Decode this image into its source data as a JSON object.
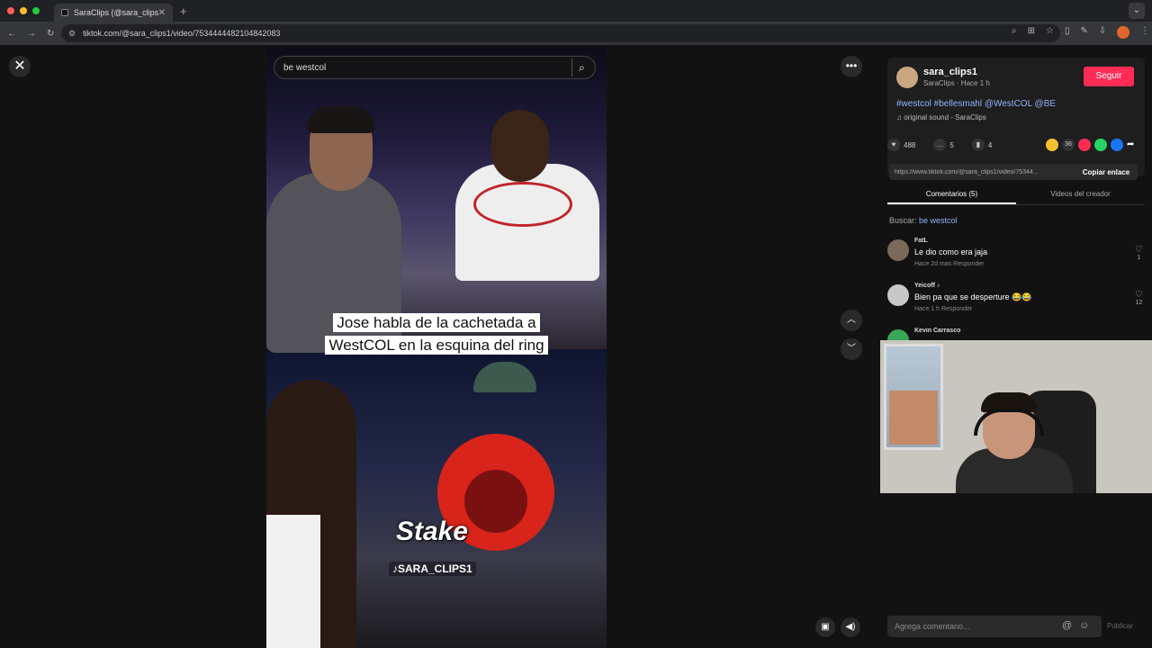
{
  "browser": {
    "tab_title": "SaraClips (@sara_clips1)",
    "tab_close": "✕",
    "new_tab": "+",
    "url": "tiktok.com/@sara_clips1/video/7534444482104842083",
    "corner": "⌄"
  },
  "video": {
    "search_text": "be westcol",
    "caption": "Jose habla de la cachetada a WestCOL en la esquina del ring",
    "sponsor": "Stake",
    "watermark": "♪SARA_CLIPS1"
  },
  "author": {
    "name": "sara_clips1",
    "sub": "SaraClips · Hace 1 h",
    "follow_label": "Seguir",
    "description": "#westcol #bellesmahl @WestCOL @BE",
    "sound": "♫ original sound - SaraClips"
  },
  "stats": {
    "likes": "488",
    "comments": "5",
    "saves": "4",
    "share_count": "36"
  },
  "link": {
    "url": "https://www.tiktok.com/@sara_clips1/video/75344...",
    "copy_label": "Copiar enlace"
  },
  "tabs": {
    "comments": "Comentarios (5)",
    "creator_videos": "Videos del creador"
  },
  "search_line": {
    "prefix": "Buscar:",
    "term": "be westcol"
  },
  "comments": [
    {
      "name": "FatL",
      "text": "Le dio como era jaja",
      "meta": "Hace 2d mas     Responder",
      "likes": "1"
    },
    {
      "name": "Yeicoff ♪",
      "text": "Bien pa que se desperture 😂😂",
      "meta": "Hace 1 h     Responder",
      "likes": "12"
    },
    {
      "name": "Kevin Carrasco",
      "text": "",
      "meta": "",
      "likes": ""
    }
  ],
  "composer": {
    "placeholder": "Agrega comentario...",
    "publish": "Publicar"
  },
  "colors": {
    "accent": "#fe2c55",
    "link": "#8fb3ff",
    "bg": "#121212"
  }
}
